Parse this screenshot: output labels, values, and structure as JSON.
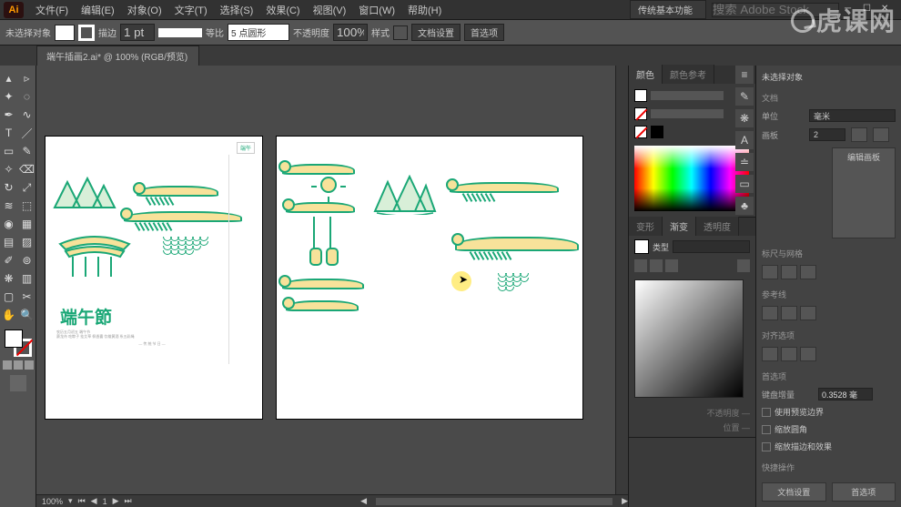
{
  "app": {
    "logo": "Ai"
  },
  "menu": {
    "items": [
      "文件(F)",
      "编辑(E)",
      "对象(O)",
      "文字(T)",
      "选择(S)",
      "效果(C)",
      "视图(V)",
      "窗口(W)",
      "帮助(H)"
    ]
  },
  "menubar_right": {
    "workspace": "传统基本功能",
    "search_placeholder": "搜索 Adobe Stock"
  },
  "options_bar": {
    "no_selection": "未选择对象",
    "stroke_label": "描边",
    "stroke_pt": "1 pt",
    "uniform": "等比",
    "shape_label": "5 点圆形",
    "opacity_label": "不透明度",
    "opacity_value": "100%",
    "style_label": "样式",
    "doc_setup": "文档设置",
    "preferences": "首选项"
  },
  "document": {
    "tab_title": "端午插画2.ai* @ 100% (RGB/预览)"
  },
  "status_bar": {
    "zoom": "100%",
    "nav": "1"
  },
  "artwork": {
    "title_text": "端午節",
    "tiny_lines": [
      "农历五月初五 端午节",
      "赛龙舟 吃粽子 挂艾草 佩香囊 饮雄黄酒 系五彩绳",
      "— 传 统 节 日 —"
    ],
    "corner_mark": "端午"
  },
  "panels": {
    "color_tab": "颜色",
    "color_tab2": "颜色参考",
    "gradient_tab": "渐变",
    "gradient_tab2": "透明度",
    "gradient_tab0": "变形",
    "type_label": "类型"
  },
  "icon_strip": {
    "items": [
      "layers-icon",
      "brush-icon",
      "symbols-icon",
      "type-icon",
      "align-icon",
      "stroke-icon",
      "clubs-icon"
    ]
  },
  "properties": {
    "header": "未选择对象",
    "doc_section": "文档",
    "unit_label": "单位",
    "unit_value": "毫米",
    "artboard_label": "画板",
    "artboard_value": "2",
    "edit_artboards": "编辑画板",
    "ruler_section": "标尺与网格",
    "guides_section": "参考线",
    "snap_section": "对齐选项",
    "prefs_section": "首选项",
    "key_increment_label": "键盘增量",
    "key_increment_value": "0.3528 毫",
    "chk1": "使用预览边界",
    "chk2": "缩放圆角",
    "chk3": "缩放描边和效果",
    "quick_section": "快捷操作",
    "btn_doc_setup": "文档设置",
    "btn_prefs": "首选项"
  },
  "watermark": "虎课网"
}
